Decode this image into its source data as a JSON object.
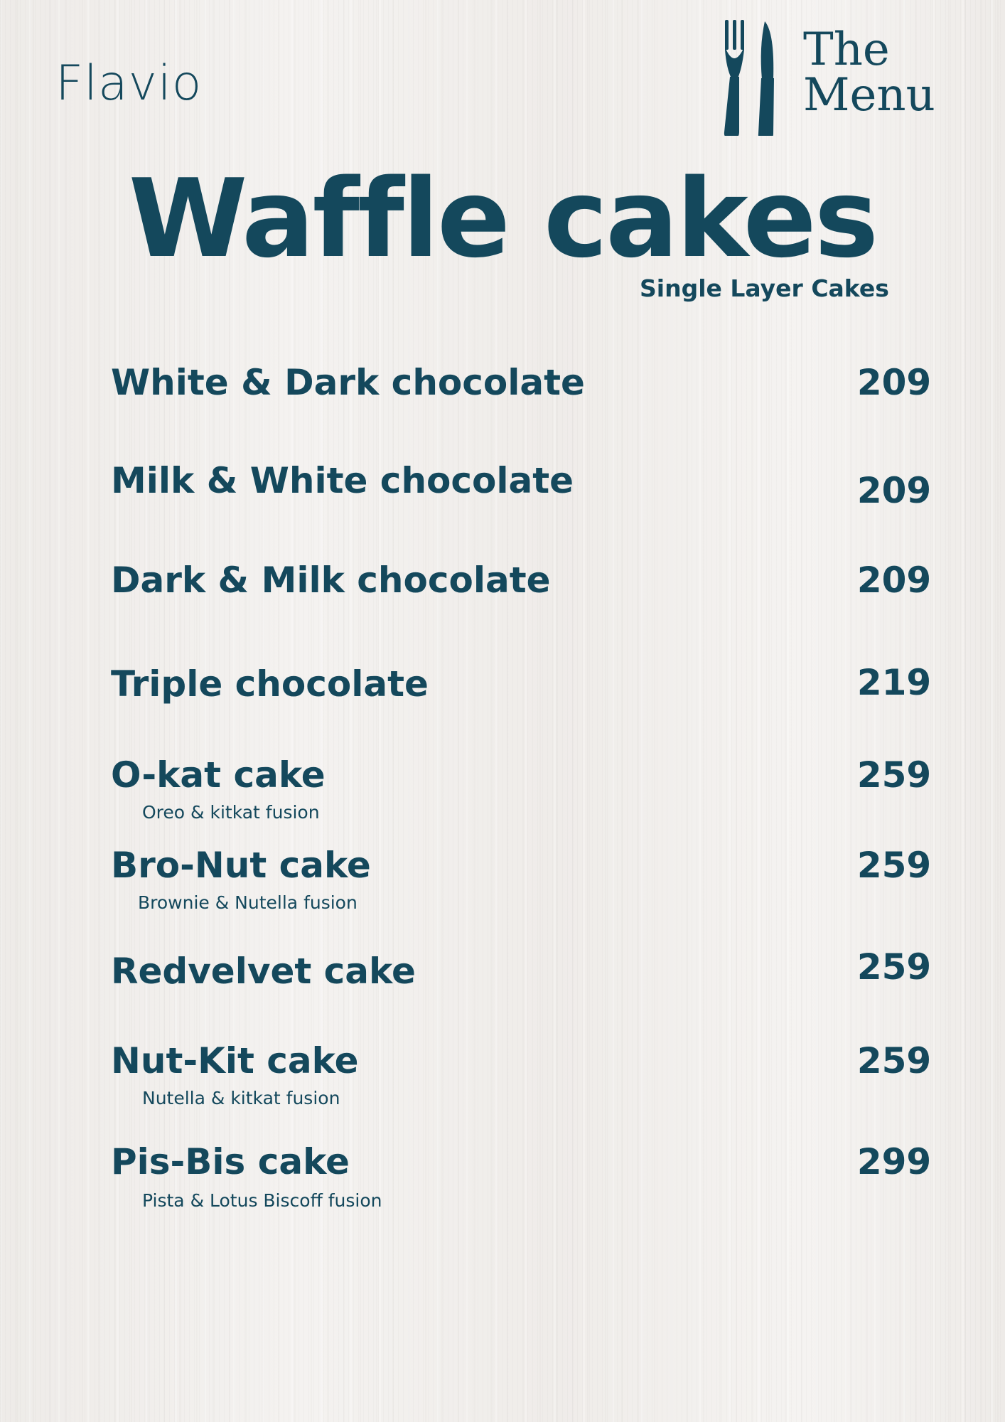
{
  "theme": {
    "ink": "#14485c",
    "background": "#f1efed"
  },
  "brand": {
    "name": "Flavio"
  },
  "logo": {
    "icon": "fork-knife-icon",
    "line1": "The",
    "line2": "Menu"
  },
  "header": {
    "title": "Waffle cakes",
    "subtitle": "Single Layer Cakes"
  },
  "menu": {
    "items": [
      {
        "name": "White & Dark chocolate",
        "price": "209"
      },
      {
        "name": "Milk & White chocolate",
        "price": "209"
      },
      {
        "name": "Dark & Milk chocolate",
        "price": "209"
      },
      {
        "name": "Triple chocolate",
        "price": "219"
      },
      {
        "name": "O-kat cake",
        "desc": "Oreo & kitkat fusion",
        "price": "259"
      },
      {
        "name": "Bro-Nut cake",
        "desc": "Brownie & Nutella fusion",
        "price": "259"
      },
      {
        "name": "Redvelvet cake",
        "price": "259"
      },
      {
        "name": "Nut-Kit cake",
        "desc": "Nutella & kitkat fusion",
        "price": "259"
      },
      {
        "name": "Pis-Bis cake",
        "desc": "Pista & Lotus Biscoff fusion",
        "price": "299"
      }
    ]
  }
}
